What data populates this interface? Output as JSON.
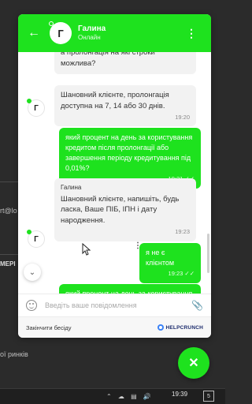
{
  "background": {
    "fragment_email": "rt@lo",
    "fragment_menu": "МЕРІ",
    "fragment_markets": "ої ринків"
  },
  "header": {
    "agent_initial": "Г",
    "agent_name": "Галина",
    "agent_status": "Онлайн"
  },
  "messages": [
    {
      "direction": "in",
      "text": "а пролонгація на які строки можлива?",
      "time": ""
    },
    {
      "direction": "in",
      "text": "Шановний клієнте, пролонгація доступна на 7, 14 або 30 днів.",
      "time": "19:20"
    },
    {
      "direction": "out",
      "text": "який процент на день за користування кредитом після пролонгації або завершення періоду кредитування під 0,01%?",
      "time": "19:21"
    },
    {
      "direction": "in",
      "sender": "Галина",
      "text": "Шановний клієнте, напишіть, будь ласка, Ваше ПІБ, ІПН і дату народження.",
      "time": "19:23"
    },
    {
      "direction": "out",
      "text": "я не є клієнтом",
      "time": "19:23"
    },
    {
      "direction": "out",
      "text": "який процент на день за користування кредитом після",
      "time": ""
    }
  ],
  "composer": {
    "placeholder": "Введіть ваше повідомлення"
  },
  "footer": {
    "end_chat": "Закінчити бесіду",
    "brand": "HELPCRUNCH"
  },
  "taskbar": {
    "time": "19:39",
    "date": "",
    "notification_count": "5"
  },
  "colors": {
    "accent": "#1ee21e",
    "bubble_in": "#f2f2f2",
    "page_bg": "#2b2b2b"
  },
  "icons": {
    "back": "arrow-left-icon",
    "menu": "kebab-icon",
    "emoji": "smile-icon",
    "attach": "paperclip-icon",
    "close": "close-icon",
    "scroll": "chevron-down-icon",
    "read": "double-check-icon"
  }
}
